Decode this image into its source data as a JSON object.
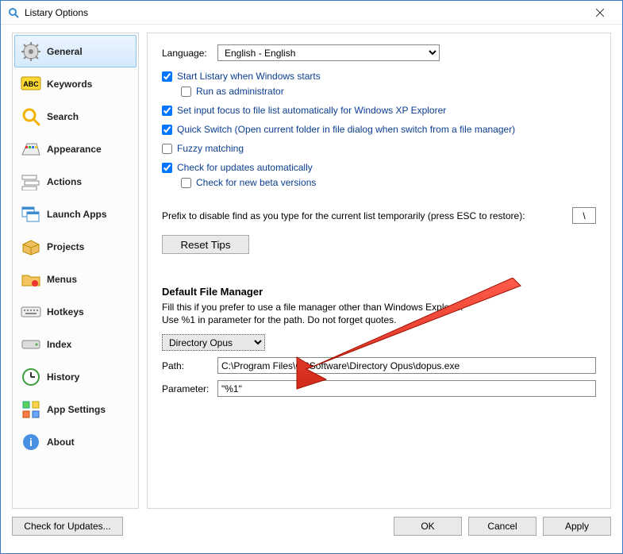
{
  "title": "Listary Options",
  "sidebar": {
    "items": [
      {
        "label": "General"
      },
      {
        "label": "Keywords"
      },
      {
        "label": "Search"
      },
      {
        "label": "Appearance"
      },
      {
        "label": "Actions"
      },
      {
        "label": "Launch Apps"
      },
      {
        "label": "Projects"
      },
      {
        "label": "Menus"
      },
      {
        "label": "Hotkeys"
      },
      {
        "label": "Index"
      },
      {
        "label": "History"
      },
      {
        "label": "App Settings"
      },
      {
        "label": "About"
      }
    ]
  },
  "general": {
    "languageLabel": "Language:",
    "languageValue": "English - English",
    "opt_start": "Start Listary when Windows starts",
    "opt_admin": "Run as administrator",
    "opt_focus": "Set input focus to file list automatically for Windows XP Explorer",
    "opt_quick": "Quick Switch (Open current folder in file dialog when switch from a file manager)",
    "opt_fuzzy": "Fuzzy matching",
    "opt_updates": "Check for updates automatically",
    "opt_beta": "Check for new beta versions",
    "prefixLabel": "Prefix to disable find as you type for the current list temporarily (press ESC to restore):",
    "prefixValue": "\\",
    "resetTips": "Reset Tips",
    "fm_title": "Default File Manager",
    "fm_desc1": "Fill this if you prefer to use a file manager other than Windows Explorer.",
    "fm_desc2": "Use %1 in parameter for the path. Do not forget quotes.",
    "fm_selected": "Directory Opus",
    "pathLabel": "Path:",
    "pathValue": "C:\\Program Files\\GPSoftware\\Directory Opus\\dopus.exe",
    "paramLabel": "Parameter:",
    "paramValue": "\"%1\""
  },
  "footer": {
    "checkUpdates": "Check for Updates...",
    "ok": "OK",
    "cancel": "Cancel",
    "apply": "Apply"
  }
}
